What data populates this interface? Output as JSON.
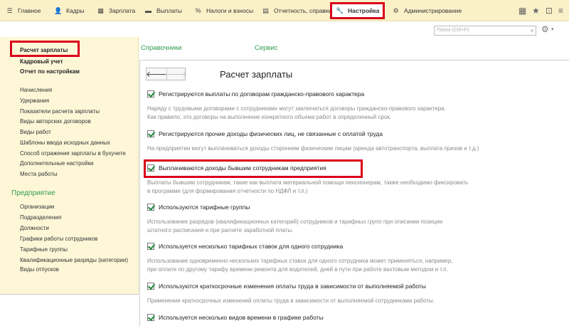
{
  "menu": {
    "home": "Главное",
    "hr": "Кадры",
    "salary": "Зарплата",
    "payments": "Выплаты",
    "taxes": "Налоги и взносы",
    "reports": "Отчетность, справки",
    "settings": "Настройка",
    "admin": "Администрирование"
  },
  "search": {
    "placeholder": "Поиск (Ctrl+F)"
  },
  "left_panel": {
    "top_items": [
      "Расчет зарплаты",
      "Кадровый учет",
      "Отчет по настройкам"
    ],
    "items": [
      "Начисления",
      "Удержания",
      "Показатели расчета зарплаты",
      "Виды авторских договоров",
      "Виды работ",
      "Шаблоны ввода исходных данных",
      "Способ отражения зарплаты в бухучете",
      "Дополнительные настройки",
      "Места работы"
    ],
    "section": "Предприятие",
    "section_items": [
      "Организации",
      "Подразделения",
      "Должности",
      "Графики работы сотрудников",
      "Тарифные группы",
      "Квалификационные разряды (категории)",
      "Виды отпусков"
    ]
  },
  "tabs": {
    "references": "Справочники",
    "service": "Сервис"
  },
  "content": {
    "title": "Расчет зарплаты",
    "options": [
      {
        "label": "Регистрируются выплаты по договорам гражданско-правового характера",
        "desc": [
          "Наряду с трудовыми договорами с сотрудниками могут заключаться договоры гражданско-правового характера.",
          "Как правило, это договоры на выполнение конкретного объема работ в определенный срок."
        ]
      },
      {
        "label": "Регистрируются прочие доходы физических лиц, не связанные с оплатой труда",
        "desc": [
          "На предприятии могут выплачиваться доходы сторонним физическим лицам (аренда автотранспорта, выплата призов и т.д.)"
        ]
      },
      {
        "label": "Выплачиваются доходы бывшим сотрудникам предприятия",
        "desc": [
          "Выплаты бывшим сотрудникам, такие как выплата материальной помощи пенсионерам, также необходимо фиксировать",
          "в программе (для формирования отчетности по НДФЛ и т.п.)"
        ]
      },
      {
        "label": "Используются тарифные группы",
        "desc": [
          "Использование разрядов (квалификационных категорий) сотрудников и тарифных групп при описании позиции",
          "штатного расписания и при расчете заработной платы."
        ]
      },
      {
        "label": "Используется несколько тарифных ставок для одного сотрудника",
        "desc": [
          "Использование одновременно нескольких тарифных ставок для одного сотрудника может применяться, например,",
          "при оплате по другому тарифу времени ремонта для водителей, дней в пути при работе вахтовым методом и т.п."
        ]
      },
      {
        "label": "Используются краткосрочные изменения оплаты труда в зависимости от выполняемой работы",
        "desc": [
          "Применение краткосрочных изменений оплаты труда в зависимости от выполняемой сотрудниками работы."
        ]
      },
      {
        "label": "Используется несколько видов времени в графике работы",
        "desc": []
      }
    ]
  }
}
